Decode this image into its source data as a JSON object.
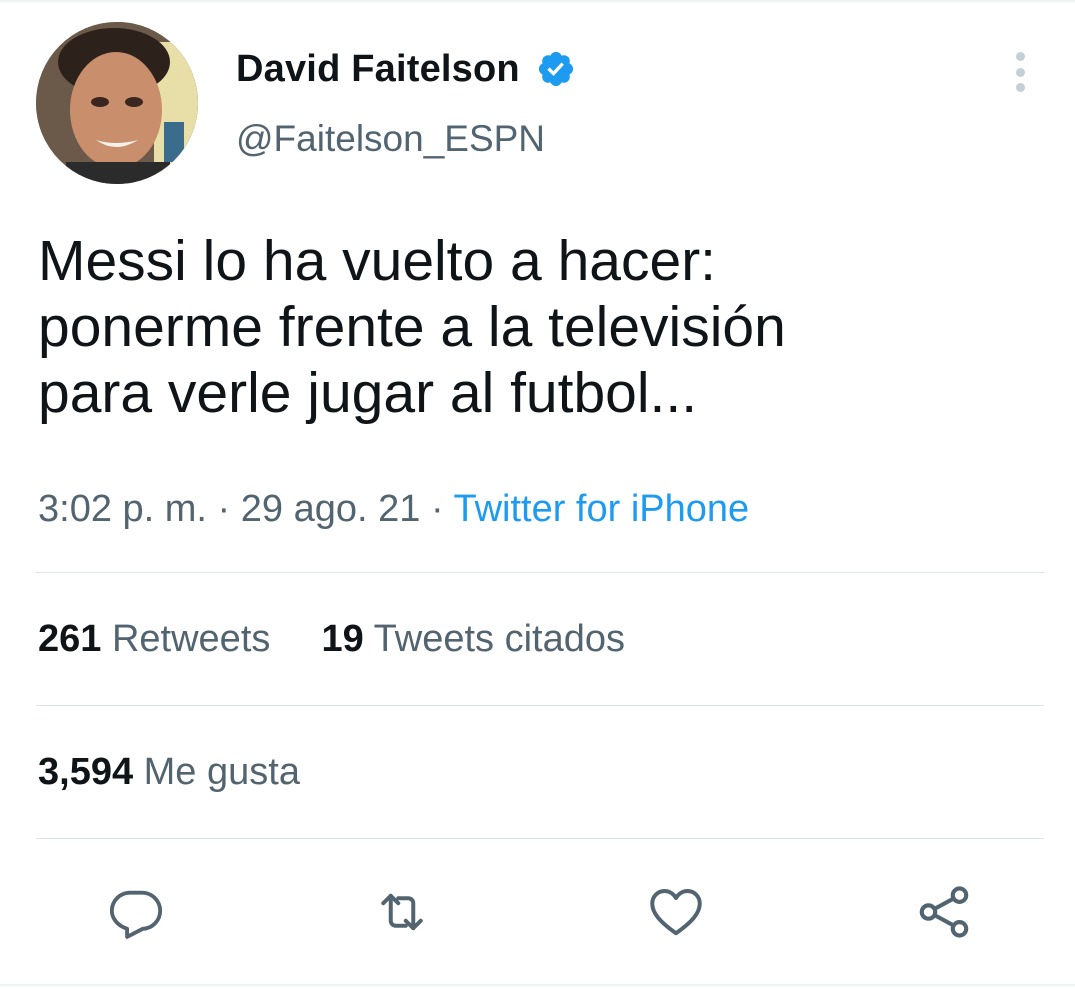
{
  "author": {
    "display_name": "David Faitelson",
    "handle": "@Faitelson_ESPN",
    "verified_icon": "verified-badge-icon"
  },
  "tweet": {
    "text": "Messi lo ha vuelto a hacer:\nponerme frente a la televisión\npara verle jugar al futbol...",
    "time": "3:02 p. m.",
    "date": "29 ago. 21",
    "separator": "·",
    "source": "Twitter for iPhone"
  },
  "stats": {
    "retweets_count": "261",
    "retweets_label": "Retweets",
    "quotes_count": "19",
    "quotes_label": "Tweets citados",
    "likes_count": "3,594",
    "likes_label": "Me gusta"
  },
  "actions": [
    "reply-icon",
    "retweet-icon",
    "like-icon",
    "share-icon"
  ],
  "colors": {
    "text": "#0f1419",
    "secondary": "#536471",
    "accent": "#1d9bf0",
    "divider": "#dfe4e7"
  }
}
